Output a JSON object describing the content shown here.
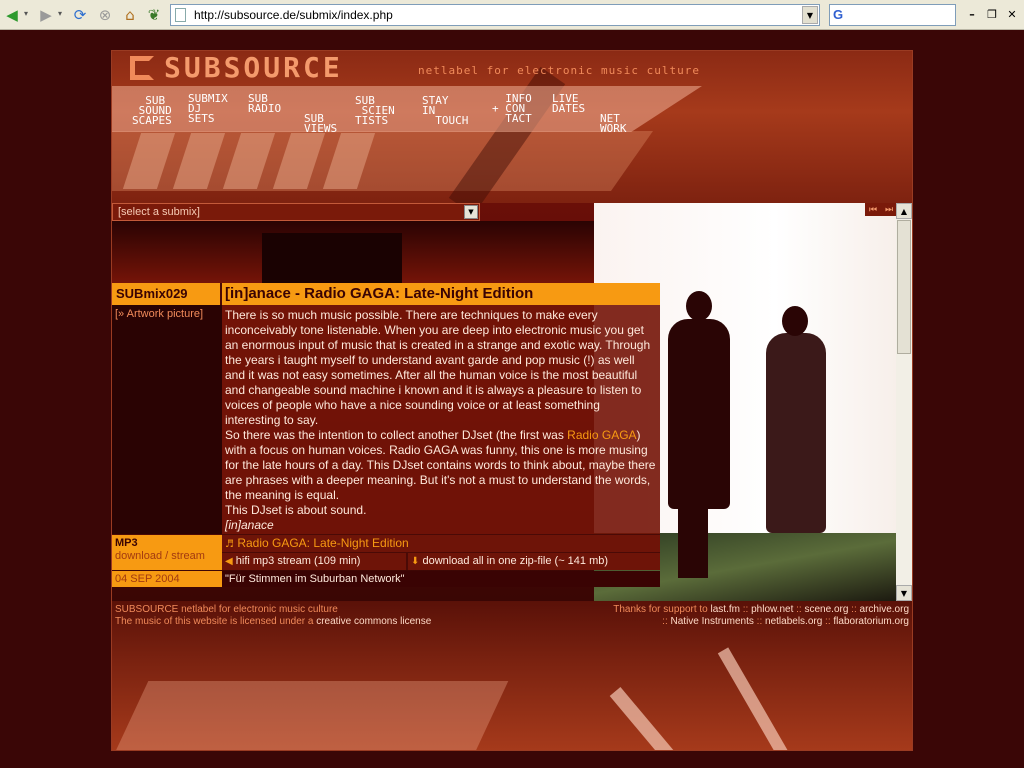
{
  "browser": {
    "url": "http://subsource.de/submix/index.php",
    "search_value": ""
  },
  "header": {
    "logo": "SUBSOURCE",
    "tagline": "netlabel for electronic music culture",
    "nav": [
      {
        "label": "  SUB\n SOUND\nSCAPES"
      },
      {
        "label": "SUBMIX\nDJ\nSETS"
      },
      {
        "label": "SUB\nRADIO"
      },
      {
        "label": "\nSUB\nVIEWS"
      },
      {
        "label": "SUB\n SCIEN\nTISTS"
      },
      {
        "label": "STAY\nIN\n  TOUCH"
      },
      {
        "label": "  INFO\n+ CON\n  TACT"
      },
      {
        "label": "LIVE\nDATES"
      },
      {
        "label": "\nNET\nWORK"
      }
    ]
  },
  "submix_select": {
    "value": "[select a submix]"
  },
  "submix": {
    "id": "SUBmix029",
    "title": "[in]anace - Radio GAGA: Late-Night Edition",
    "artwork_link": "[» Artwork picture]",
    "desc_p1": "There is so much music possible. There are techniques to make every inconceivably tone listenable. When you are deep into electronic music you get an enormous input of music that is created in a strange and exotic way. Through the years i taught myself to understand avant garde and pop music (!) as well and it was not easy sometimes. After all the human voice is the most beautiful and changeable sound machine i known and it is always a pleasure to listen to voices of people who have a nice sounding voice or at least something interesting to say.",
    "desc_p2_before": "So there was the intention to collect another DJset (the first was ",
    "desc_p2_link": "Radio GAGA",
    "desc_p2_after": ") with a focus on human voices. Radio GAGA was funny, this one is more musing for the late hours of a day. This DJset contains words to think about, maybe there are phrases with a deeper meaning. But it's not a must to understand the words, the meaning is equal.",
    "desc_p3": "This DJset is about sound.",
    "signature": "[in]anace",
    "mp3_label": "MP3",
    "mp3_sub": "download / stream",
    "track": "Radio GAGA: Late-Night Edition",
    "stream_link": "hifi mp3 stream (109 min)",
    "download_link": "download all in one zip-file (~ 141 mb)",
    "date": "04 SEP 2004",
    "event": "\"Für Stimmen im Suburban Network\""
  },
  "footer": {
    "left1_a": "SUBSOURCE netlabel for electronic music culture",
    "left2_a": "The music of this website is licensed under a ",
    "left2_link": "creative commons license",
    "right1_prefix": "Thanks for support to ",
    "right1_links": [
      "last.fm",
      "phlow.net",
      "scene.org",
      "archive.org"
    ],
    "right2_links": [
      "Native Instruments",
      "netlabels.org",
      "flaboratorium.org"
    ],
    "sep": " :: "
  }
}
